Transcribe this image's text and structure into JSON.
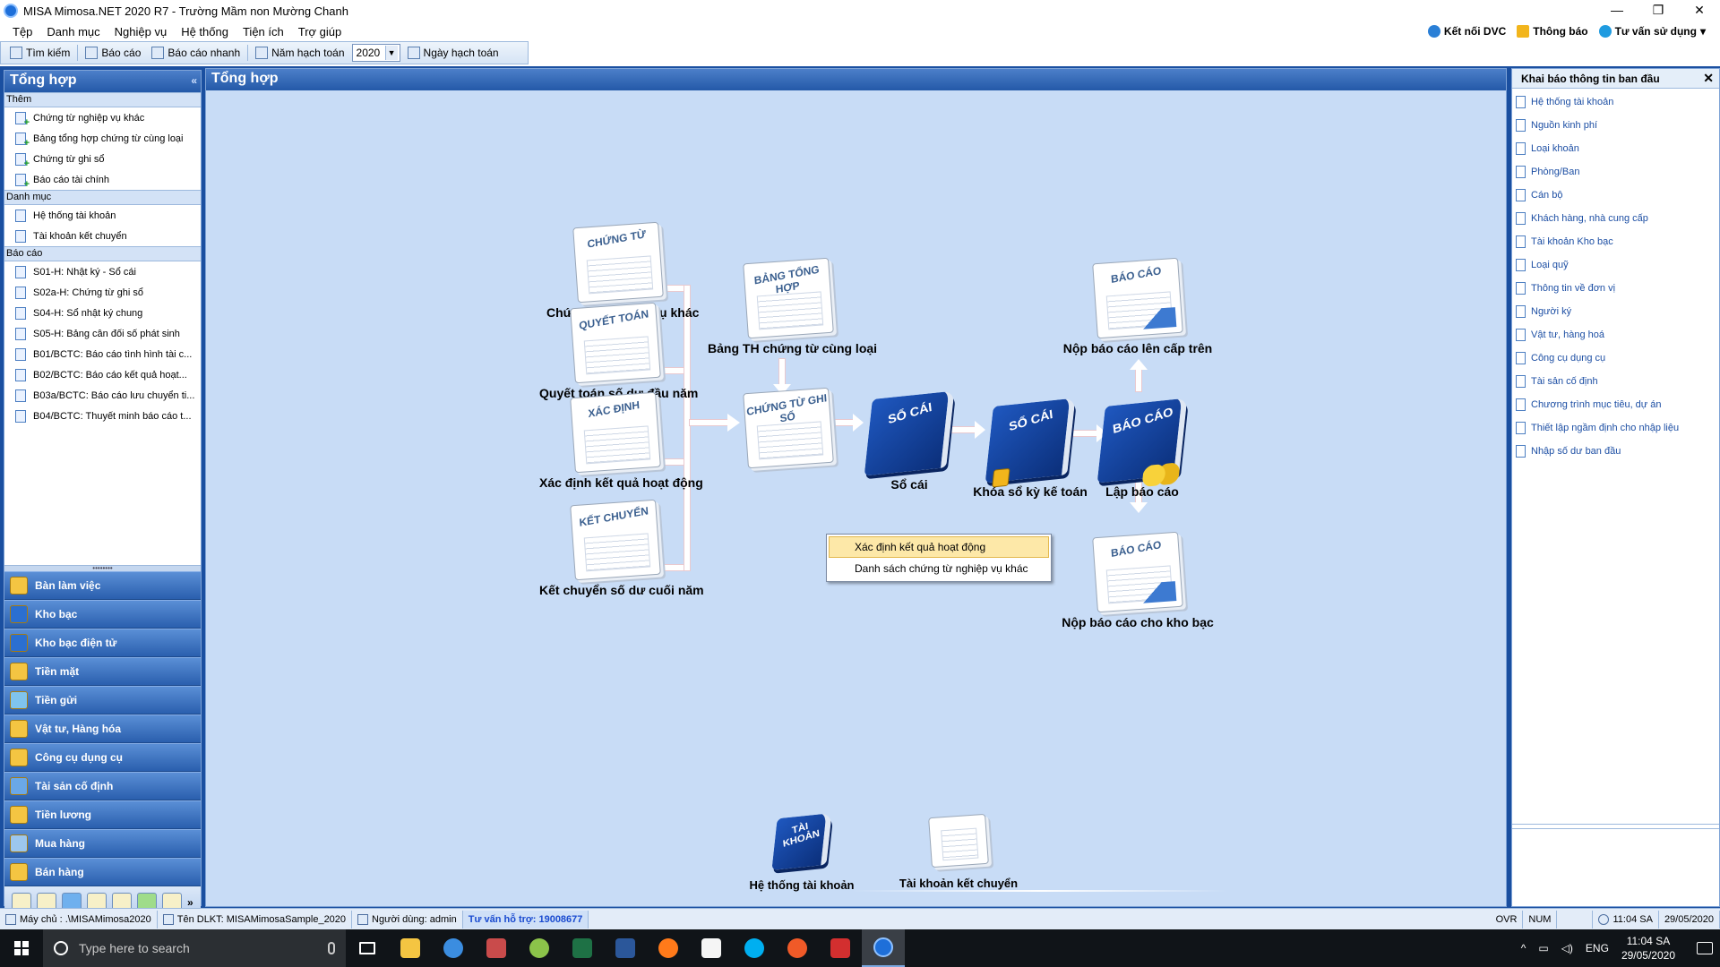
{
  "window": {
    "title": "MISA Mimosa.NET 2020 R7 - Trường Mầm non Mường Chanh",
    "controls": [
      "—",
      "❐",
      "✕"
    ]
  },
  "menubar": {
    "items": [
      "Tệp",
      "Danh mục",
      "Nghiệp vụ",
      "Hệ thống",
      "Tiện ích",
      "Trợ giúp"
    ],
    "right": {
      "connect": "Kết nối DVC",
      "notify": "Thông báo",
      "advice": "Tư vấn sử dụng"
    }
  },
  "toolbar": {
    "search": "Tìm kiếm",
    "report": "Báo cáo",
    "quick_report": "Báo cáo nhanh",
    "fiscal_year_label": "Năm hạch toán",
    "fiscal_year_value": "2020",
    "posting_date": "Ngày hạch toán"
  },
  "left_panel": {
    "title": "Tổng hợp",
    "sections": [
      {
        "label": "Thêm",
        "items": [
          "Chứng từ nghiệp vụ khác",
          "Bảng tổng hợp chứng từ cùng loại",
          "Chứng từ ghi sổ",
          "Báo cáo tài chính"
        ]
      },
      {
        "label": "Danh mục",
        "items": [
          "Hệ thống tài khoản",
          "Tài khoản kết chuyển"
        ]
      },
      {
        "label": "Báo cáo",
        "items": [
          "S01-H: Nhật ký - Sổ cái",
          "S02a-H: Chứng từ ghi sổ",
          "S04-H: Sổ nhật ký chung",
          "S05-H: Bảng cân đối số phát sinh",
          "B01/BCTC: Báo cáo tình hình tài c...",
          "B02/BCTC: Báo cáo kết quả hoạt...",
          "B03a/BCTC: Báo cáo lưu chuyển ti...",
          "B04/BCTC: Thuyết minh báo cáo t..."
        ]
      }
    ],
    "splitter": "••••••••",
    "nav": [
      "Bàn làm việc",
      "Kho bạc",
      "Kho bạc điện tử",
      "Tiền mặt",
      "Tiền gửi",
      "Vật tư, Hàng hóa",
      "Công cụ dụng cụ",
      "Tài sản cố định",
      "Tiền lương",
      "Mua hàng",
      "Bán hàng"
    ],
    "nav_more": "»"
  },
  "center": {
    "title": "Tổng hợp",
    "nodes": {
      "chung_tu": {
        "card": "CHỨNG TỪ",
        "label": "Chứng từ nghiệp vụ khác"
      },
      "quyet_toan": {
        "card": "QUYẾT TOÁN",
        "label": "Quyết toán số dư đầu năm"
      },
      "xac_dinh": {
        "card": "XÁC ĐỊNH",
        "label": "Xác định kết quả hoạt động"
      },
      "ket_chuyen": {
        "card": "KẾT CHUYỂN",
        "label": "Kết chuyển số dư cuối năm"
      },
      "bang_tong_hop": {
        "card": "BẢNG TỔNG HỢP",
        "label": "Bảng TH chứng từ cùng loại"
      },
      "chung_tu_ghi_so": {
        "card": "CHỨNG TỪ GHI SỔ",
        "label": ""
      },
      "so_cai": {
        "card": "SỔ CÁI",
        "label": "Sổ cái"
      },
      "khoa_so": {
        "card": "SỔ CÁI",
        "label": "Khóa sổ kỳ kế toán"
      },
      "lap_bao_cao": {
        "card": "BÁO CÁO",
        "label": "Lập báo cáo"
      },
      "nop_cap_tren": {
        "card": "BÁO CÁO",
        "label": "Nộp báo cáo lên cấp trên"
      },
      "nop_kho_bac": {
        "card": "BÁO CÁO",
        "label": "Nộp báo cáo cho kho bạc"
      },
      "he_thong_tk": {
        "card": "TÀI KHOẢN",
        "label": "Hệ thống tài khoản"
      },
      "tk_ket_chuyen": {
        "card": "",
        "label": "Tài khoản kết chuyển"
      }
    },
    "context_menu": [
      "Xác định kết quả hoạt động",
      "Danh sách chứng từ nghiệp vụ khác"
    ]
  },
  "right_panel": {
    "title": "Khai báo thông tin ban đầu",
    "close": "✕",
    "items": [
      "Hệ thống tài khoản",
      "Nguồn kinh phí",
      "Loại khoản",
      "Phòng/Ban",
      "Cán bộ",
      "Khách hàng, nhà cung cấp",
      "Tài khoản Kho bạc",
      "Loại quỹ",
      "Thông tin về đơn vị",
      "Người ký",
      "Vật tư, hàng hoá",
      "Công cụ dụng cụ",
      "Tài sản cố định",
      "Chương trình mục tiêu, dự án",
      "Thiết lập ngầm định cho nhập liệu",
      "Nhập số dư ban đầu"
    ]
  },
  "statusbar": {
    "server": "Máy chủ : .\\MISAMimosa2020",
    "db": "Tên DLKT: MISAMimosaSample_2020",
    "user": "Người dùng: admin",
    "hotline": "Tư vấn hỗ trợ: 19008677",
    "ovr": "OVR",
    "num": "NUM",
    "time": "11:04 SA",
    "date": "29/05/2020"
  },
  "taskbar": {
    "search_placeholder": "Type here to search",
    "lang": "ENG",
    "time": "11:04 SA",
    "date": "29/05/2020",
    "tray_up": "^"
  },
  "colors": {
    "header_blue": "#2459a8",
    "canvas_bg": "#c8dcf6",
    "menu_highlight": "#fde8a8",
    "link_blue": "#1d4fa4"
  }
}
